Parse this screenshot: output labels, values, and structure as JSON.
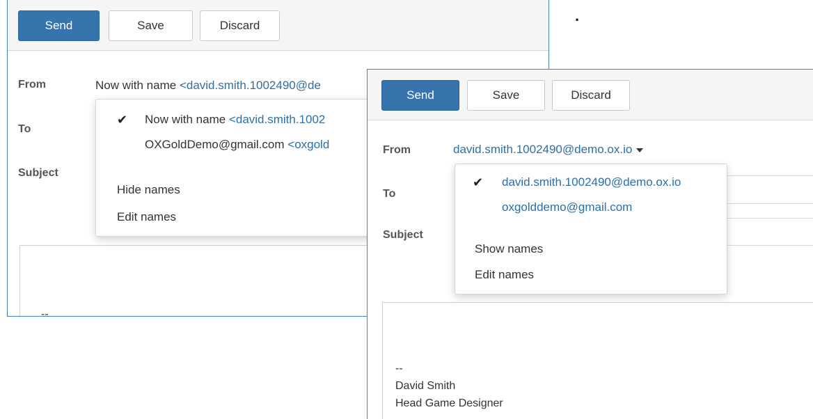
{
  "win1": {
    "toolbar": {
      "send": "Send",
      "save": "Save",
      "discard": "Discard"
    },
    "labels": {
      "from": "From",
      "to": "To",
      "subject": "Subject"
    },
    "from_name": "Now with name ",
    "from_email": "<david.smith.1002490@de",
    "dropdown": {
      "items": [
        {
          "name": "Now with name ",
          "email": "<david.smith.1002",
          "checked": true
        },
        {
          "name": "OXGoldDemo@gmail.com ",
          "email": "<oxgold",
          "checked": false
        }
      ],
      "hide_names": "Hide names",
      "edit_names": "Edit names"
    },
    "editor_text": "--"
  },
  "win2": {
    "toolbar": {
      "send": "Send",
      "save": "Save",
      "discard": "Discard"
    },
    "labels": {
      "from": "From",
      "to": "To",
      "subject": "Subject"
    },
    "from_email": "david.smith.1002490@demo.ox.io",
    "dropdown": {
      "items": [
        {
          "email": "david.smith.1002490@demo.ox.io",
          "checked": true
        },
        {
          "email": "oxgolddemo@gmail.com",
          "checked": false
        }
      ],
      "show_names": "Show names",
      "edit_names": "Edit names"
    },
    "signature": {
      "dashes": "--",
      "name": "David Smith",
      "title": "Head Game Designer"
    }
  },
  "stray_mark": "."
}
